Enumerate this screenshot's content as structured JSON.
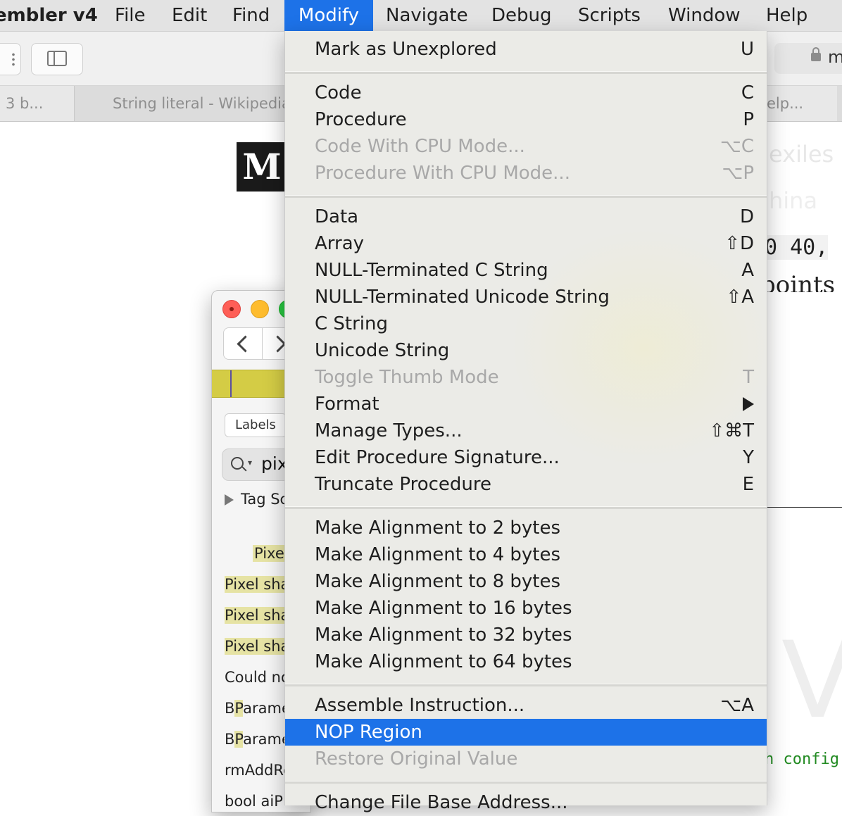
{
  "menubar": {
    "app_name": "embler v4",
    "items": [
      "File",
      "Edit",
      "Find",
      "Modify",
      "Navigate",
      "Debug",
      "Scripts",
      "Window",
      "Help"
    ]
  },
  "browser": {
    "url_partial": "m",
    "tabs": [
      "3 b...",
      "String literal - Wikipedia",
      "elp..."
    ]
  },
  "page": {
    "logo_letter": "M",
    "code_snippet": "0 40,",
    "word_partial": "points",
    "blur_text_1": "exiles",
    "blur_text_2": "hina",
    "big_letter": "V",
    "green_code": "h config'"
  },
  "hopper": {
    "labels_button": "Labels",
    "search_value": "pix",
    "tag_row": "Tag Sc",
    "list": [
      {
        "text": "Pixel",
        "highlight": "Pixel",
        "rest": ""
      },
      {
        "text": "Pixel sha",
        "highlight": "Pixel",
        "rest": " sha"
      },
      {
        "text": "Pixel sha",
        "highlight": "Pixel",
        "rest": " sha"
      },
      {
        "text": "Pixel sha",
        "highlight": "Pixel",
        "rest": " sha"
      },
      {
        "text": "Could no",
        "highlight": "",
        "rest": "Could no"
      },
      {
        "text": "BParame",
        "highlight": "P",
        "rest": "arame"
      },
      {
        "text": "BParame",
        "highlight": "P",
        "rest": "arame"
      },
      {
        "text": "rmAddRe",
        "highlight": "",
        "rest": "rmAddRe"
      },
      {
        "text": "bool aiP",
        "highlight": "",
        "rest": "bool aiP"
      }
    ]
  },
  "modify_menu": {
    "items": [
      {
        "label": "Mark as Unexplored",
        "shortcut": "U",
        "disabled": false
      },
      {
        "label": "Code",
        "shortcut": "C",
        "disabled": false
      },
      {
        "label": "Procedure",
        "shortcut": "P",
        "disabled": false
      },
      {
        "label": "Code With CPU Mode...",
        "shortcut": "⌥C",
        "disabled": true
      },
      {
        "label": "Procedure With CPU Mode...",
        "shortcut": "⌥P",
        "disabled": true
      },
      {
        "label": "Data",
        "shortcut": "D",
        "disabled": false
      },
      {
        "label": "Array",
        "shortcut": "⇧D",
        "disabled": false
      },
      {
        "label": "NULL-Terminated C String",
        "shortcut": "A",
        "disabled": false
      },
      {
        "label": "NULL-Terminated Unicode String",
        "shortcut": "⇧A",
        "disabled": false
      },
      {
        "label": "C String",
        "shortcut": "",
        "disabled": false
      },
      {
        "label": "Unicode String",
        "shortcut": "",
        "disabled": false
      },
      {
        "label": "Toggle Thumb Mode",
        "shortcut": "T",
        "disabled": true
      },
      {
        "label": "Format",
        "shortcut": "",
        "disabled": false,
        "submenu": true
      },
      {
        "label": "Manage Types...",
        "shortcut": "⇧⌘T",
        "disabled": false
      },
      {
        "label": "Edit Procedure Signature...",
        "shortcut": "Y",
        "disabled": false
      },
      {
        "label": "Truncate Procedure",
        "shortcut": "E",
        "disabled": false
      },
      {
        "label": "Make Alignment to 2 bytes",
        "shortcut": "",
        "disabled": false
      },
      {
        "label": "Make Alignment to 4 bytes",
        "shortcut": "",
        "disabled": false
      },
      {
        "label": "Make Alignment to 8 bytes",
        "shortcut": "",
        "disabled": false
      },
      {
        "label": "Make Alignment to 16 bytes",
        "shortcut": "",
        "disabled": false
      },
      {
        "label": "Make Alignment to 32 bytes",
        "shortcut": "",
        "disabled": false
      },
      {
        "label": "Make Alignment to 64 bytes",
        "shortcut": "",
        "disabled": false
      },
      {
        "label": "Assemble Instruction...",
        "shortcut": "⌥A",
        "disabled": false
      },
      {
        "label": "NOP Region",
        "shortcut": "",
        "disabled": false,
        "selected": true
      },
      {
        "label": "Restore Original Value",
        "shortcut": "",
        "disabled": true
      },
      {
        "label": "Change File Base Address...",
        "shortcut": "",
        "disabled": false
      }
    ]
  },
  "colors": {
    "accent": "#1d72e8",
    "menu_bg": "#ebebe7",
    "disabled_text": "#a8a8a8",
    "highlight_yellow": "#e6e3a4"
  }
}
